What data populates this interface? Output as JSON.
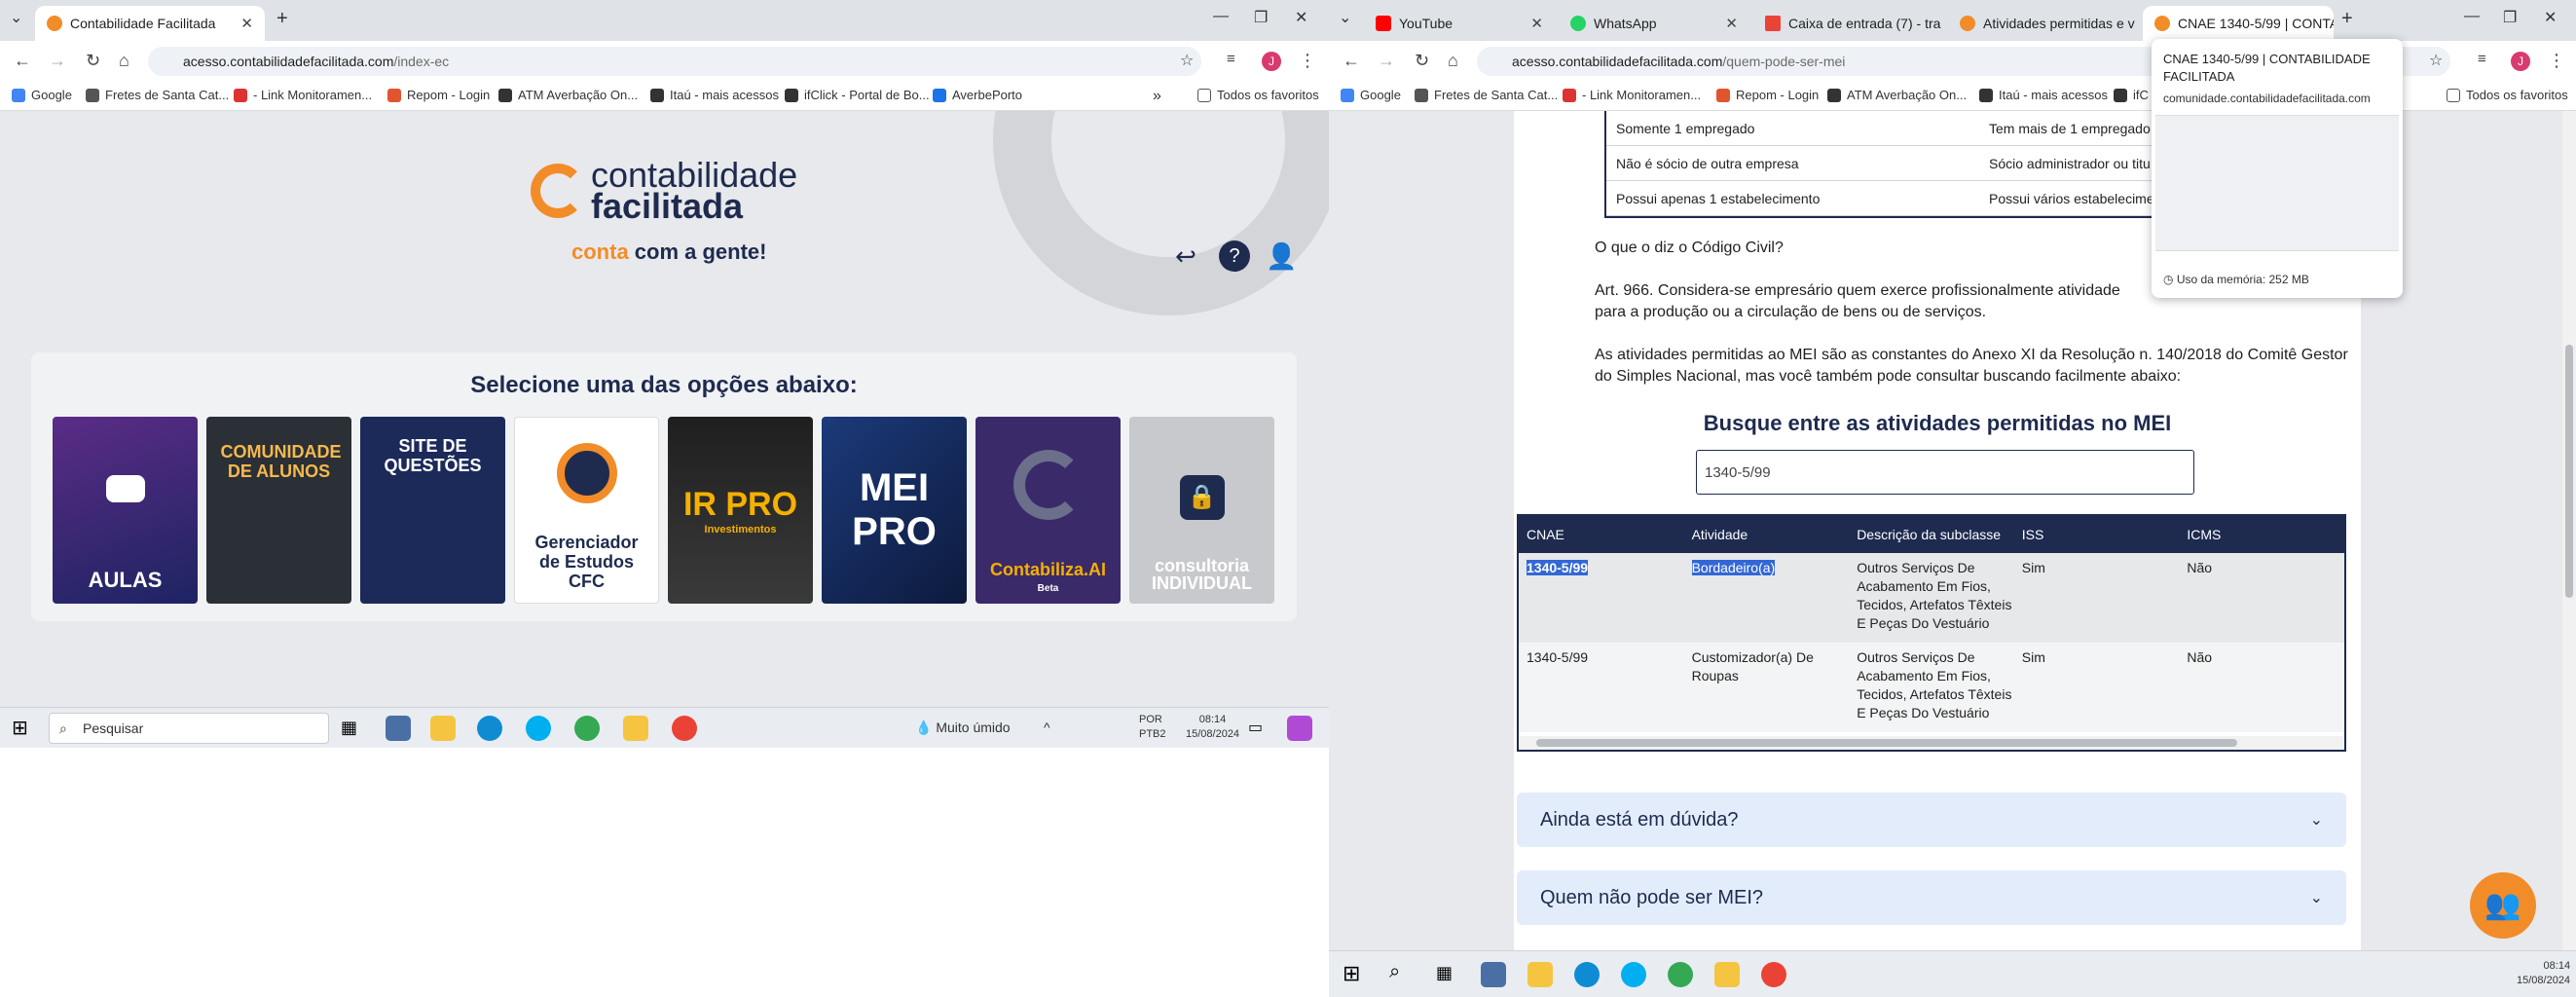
{
  "left_window": {
    "tab": {
      "title": "Contabilidade Facilitada",
      "close": "✕",
      "new": "+"
    },
    "url": {
      "host": "acesso.contabilidadefacilitada.com",
      "path": "/index-ec"
    },
    "bookmarks": [
      "Google",
      "Fretes de Santa Cat...",
      "- Link Monitoramen...",
      "Repom - Login",
      "ATM Averbação On...",
      "Itaú - mais acessos",
      "ifClick - Portal de Bo...",
      "AverbePorto"
    ],
    "bookmarks_more": "»",
    "brand": {
      "line1": "contabilidade",
      "line2": "facilitada",
      "tagline_accent": "conta",
      "tagline_rest": " com a gente!"
    },
    "options_title": "Selecione uma das opções abaixo:",
    "cards": [
      {
        "label": "AULAS",
        "color": "#2a2a6e"
      },
      {
        "label": "COMUNIDADE DE ALUNOS",
        "color": "#2b2f36"
      },
      {
        "label": "SITE DE QUESTÕES",
        "color": "#1c2a5a"
      },
      {
        "label": "Gerenciador de Estudos CFC",
        "color": "#ffffff"
      },
      {
        "label": "IR PRO",
        "sub": "Investimentos",
        "color": "#1f1f1f"
      },
      {
        "label": "MEI PRO",
        "color": "#1c3a7a"
      },
      {
        "label": "Contabiliza.AI",
        "sub": "Beta",
        "color": "#3a2a6a"
      },
      {
        "label": "consultoria INDIVIDUAL",
        "color": "#c8c9cc"
      }
    ],
    "taskbar": {
      "search": "Pesquisar",
      "weather": "Muito úmido",
      "lang1": "POR",
      "lang2": "PTB2",
      "time": "08:14",
      "date": "15/08/2024"
    }
  },
  "right_window": {
    "tabs": [
      {
        "title": "YouTube",
        "color": "#ff0000"
      },
      {
        "title": "WhatsApp",
        "color": "#25d366"
      },
      {
        "title": "Caixa de entrada (7) - tra",
        "color": "#ea4335"
      },
      {
        "title": "Atividades permitidas e v",
        "color": "#f28c28"
      },
      {
        "title": "CNAE 1340-5/99 | CONTA",
        "color": "#f28c28"
      }
    ],
    "url": {
      "host": "acesso.contabilidadefacilitada.com",
      "path": "/quem-pode-ser-mei"
    },
    "bookmarks": [
      "Google",
      "Fretes de Santa Cat...",
      "- Link Monitoramen...",
      "Repom - Login",
      "ATM Averbação On...",
      "Itaú - mais acessos",
      "ifC"
    ],
    "bookmarks_all": "Todos os favoritos",
    "compare_rows": [
      [
        "Somente 1 empregado",
        "Tem mais de 1 empregado"
      ],
      [
        "Não é sócio de outra empresa",
        "Sócio administrador ou titu"
      ],
      [
        "Possui apenas 1 estabelecimento",
        "Possui vários estabelecime"
      ]
    ],
    "q_title": "O que o diz o Código Civil?",
    "art_text": "Art. 966. Considera-se empresário quem exerce profissionalmente atividade",
    "art_text2": "para a produção ou a circulação de bens ou de serviços.",
    "mei_text": "As atividades permitidas ao MEI são as constantes do Anexo XI da Resolução n. 140/2018 do Comitê Gestor do Simples Nacional, mas você também pode consultar buscando facilmente abaixo:",
    "search_title": "Busque entre as atividades permitidas no MEI",
    "search_value": "1340-5/99",
    "results_headers": [
      "CNAE",
      "Atividade",
      "Descrição da subclasse",
      "ISS",
      "ICMS"
    ],
    "results_rows": [
      {
        "cnae": "1340-5/99",
        "atividade": "Bordadeiro(a)",
        "descricao": "Outros Serviços De Acabamento Em Fios, Tecidos, Artefatos Têxteis E Peças Do Vestuário",
        "iss": "Sim",
        "icms": "Não"
      },
      {
        "cnae": "1340-5/99",
        "atividade": "Customizador(a) De Roupas",
        "descricao": "Outros Serviços De Acabamento Em Fios, Tecidos, Artefatos Têxteis E Peças Do Vestuário",
        "iss": "Sim",
        "icms": "Não"
      }
    ],
    "faq": [
      "Ainda está em dúvida?",
      "Quem não pode ser MEI?"
    ],
    "hovercard": {
      "title": "CNAE 1340-5/99 | CONTABILIDADE FACILITADA",
      "url": "comunidade.contabilidadefacilitada.com",
      "memory": "Uso da memória: 252 MB"
    },
    "taskbar": {
      "time": "08:14",
      "date": "15/08/2024"
    }
  }
}
